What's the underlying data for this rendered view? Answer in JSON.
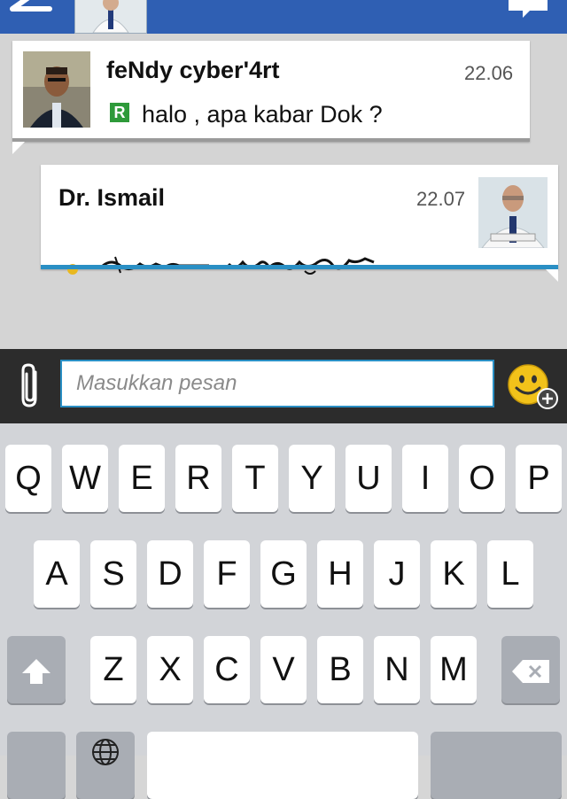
{
  "header": {
    "back_icon": "back-arrow-icon",
    "contact_avatar": "doctor-avatar",
    "chat_icon": "chat-bubble-icon",
    "color": "#2f5fb3"
  },
  "messages": [
    {
      "sender": "feNdy cyber'4rt",
      "time": "22.06",
      "badge": "R",
      "text": "halo , apa kabar Dok ?",
      "accent": "#9a9a9a"
    },
    {
      "sender": "Dr. Ismail",
      "time": "22.07",
      "accent": "#2a8fc4",
      "status_dot_color": "#e8b820"
    }
  ],
  "compose": {
    "placeholder": "Masukkan pesan",
    "attach_icon": "paperclip-icon",
    "emoji_icon": "smiley-add-icon"
  },
  "keyboard": {
    "row1": [
      "Q",
      "W",
      "E",
      "R",
      "T",
      "Y",
      "U",
      "I",
      "O",
      "P"
    ],
    "row2": [
      "A",
      "S",
      "D",
      "F",
      "G",
      "H",
      "J",
      "K",
      "L"
    ],
    "row3": [
      "Z",
      "X",
      "C",
      "V",
      "B",
      "N",
      "M"
    ],
    "shift_icon": "shift-arrow-icon",
    "backspace_icon": "backspace-icon",
    "globe_icon": "globe-icon"
  }
}
